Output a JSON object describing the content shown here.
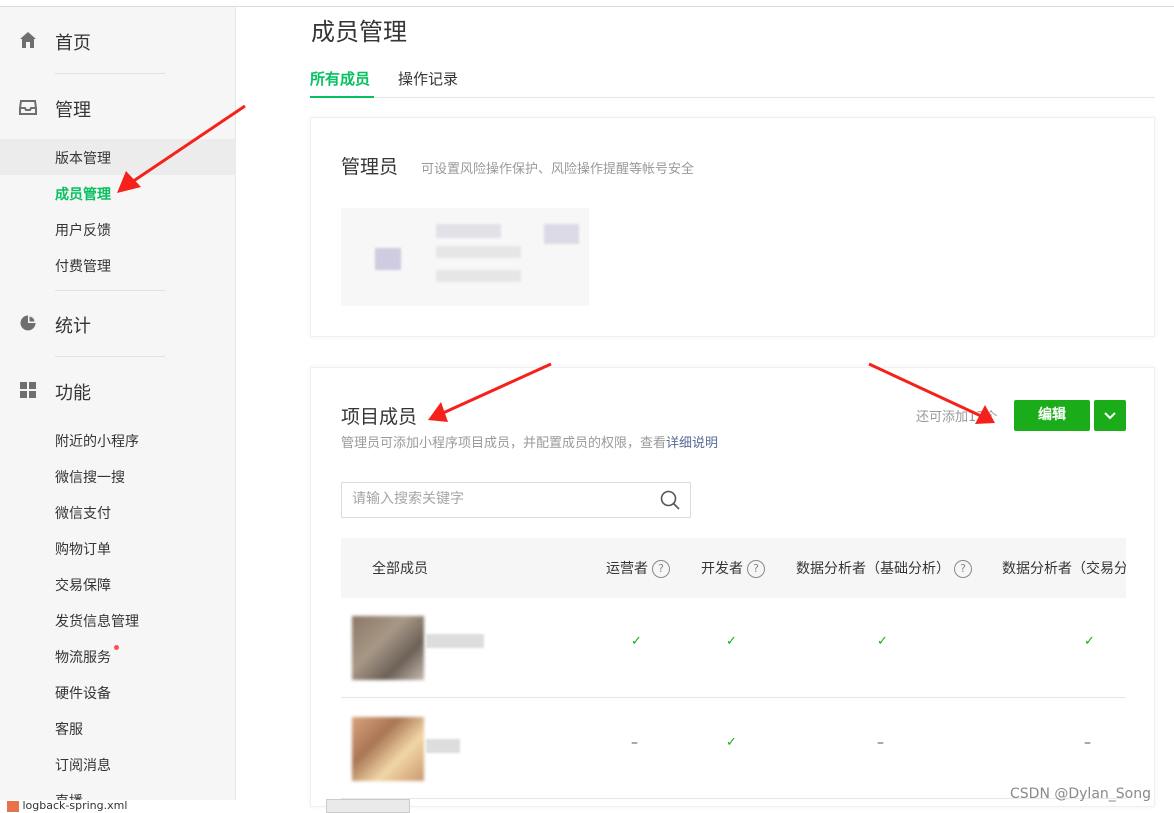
{
  "sidebar": {
    "sections": [
      {
        "label": "首页",
        "icon": "home-icon"
      },
      {
        "label": "管理",
        "icon": "inbox-icon"
      },
      {
        "label": "统计",
        "icon": "pie-chart-icon"
      },
      {
        "label": "功能",
        "icon": "grid-icon"
      }
    ],
    "manage_items": [
      "版本管理",
      "成员管理",
      "用户反馈",
      "付费管理"
    ],
    "feature_items": [
      "附近的小程序",
      "微信搜一搜",
      "微信支付",
      "购物订单",
      "交易保障",
      "发货信息管理",
      "物流服务",
      "硬件设备",
      "客服",
      "订阅消息",
      "直播"
    ],
    "active_item": "成员管理"
  },
  "main": {
    "title": "成员管理",
    "tabs": [
      {
        "label": "所有成员",
        "active": true
      },
      {
        "label": "操作记录",
        "active": false
      }
    ],
    "admin_card": {
      "title": "管理员",
      "desc": "可设置风险操作保护、风险操作提醒等帐号安全"
    },
    "members_card": {
      "title": "项目成员",
      "desc": "管理员可添加小程序项目成员，并配置成员的权限，查看",
      "desc_link": "详细说明",
      "remaining": "还可添加13个",
      "edit_button": "编辑",
      "search_placeholder": "请输入搜索关键字",
      "columns": [
        "全部成员",
        "运营者",
        "开发者",
        "数据分析者（基础分析）",
        "数据分析者（交易分"
      ],
      "help_mark": "?",
      "rows": [
        {
          "values": [
            "✓",
            "✓",
            "✓",
            "✓"
          ]
        },
        {
          "values": [
            "–",
            "✓",
            "–",
            "–"
          ]
        }
      ]
    }
  },
  "footer": {
    "file": "logback-spring.xml",
    "watermark": "CSDN @Dylan_Song"
  },
  "colors": {
    "accent": "#07c160",
    "button": "#1aad19",
    "annotation_arrow": "#f5221b"
  }
}
